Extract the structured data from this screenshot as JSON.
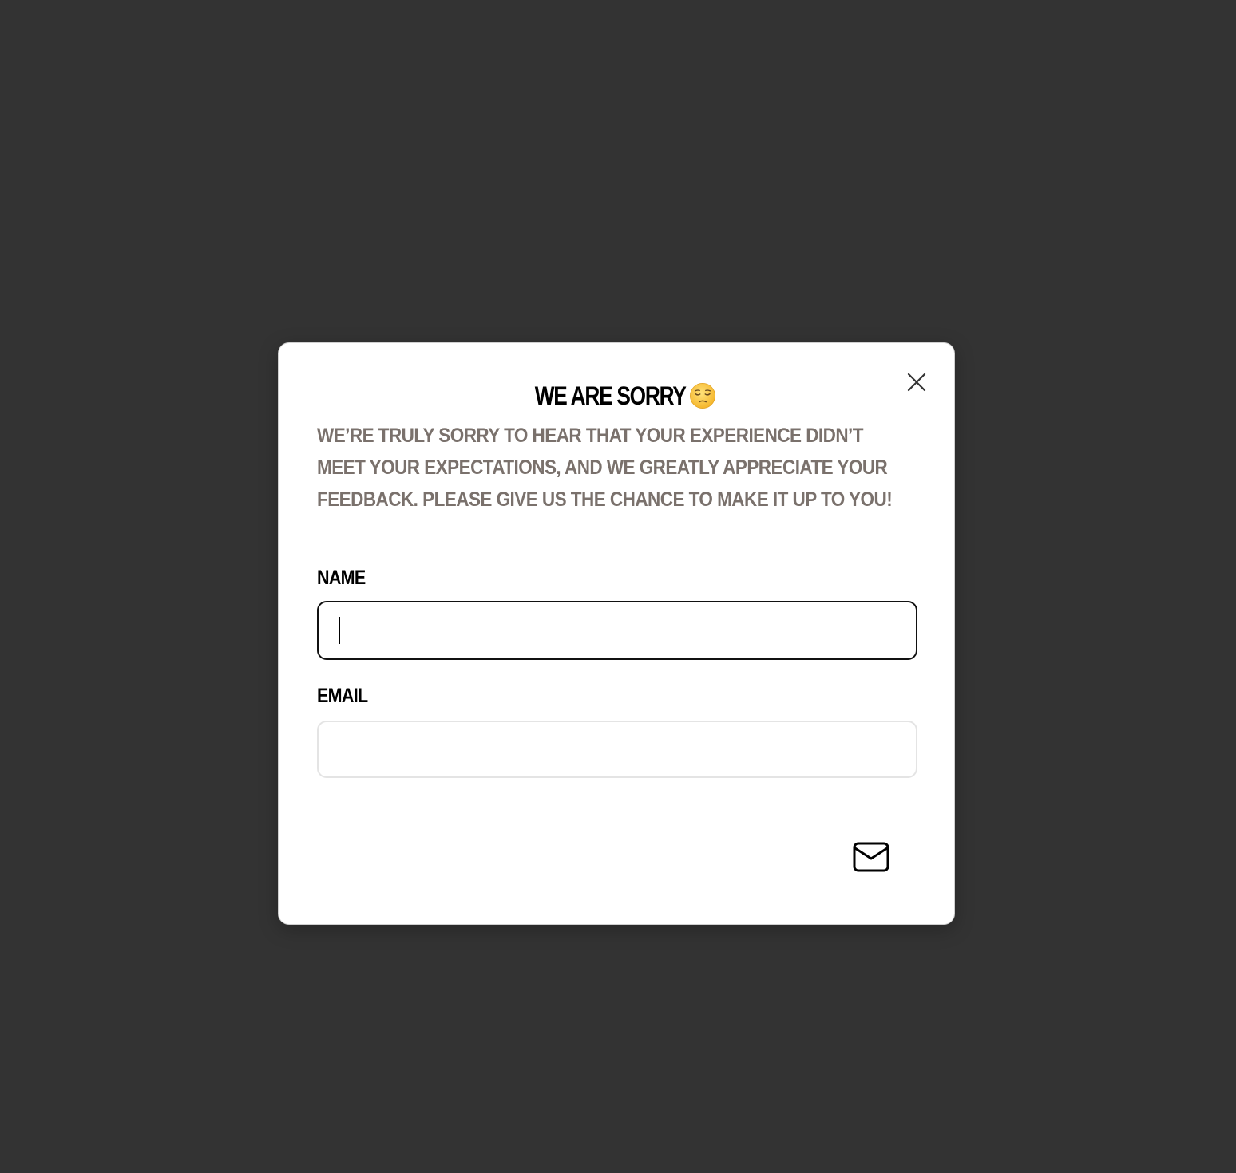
{
  "modal": {
    "title": "We are sorry",
    "title_emoji": "pensive-face-icon",
    "description": "We’re truly sorry to hear that your experience didn’t meet your expectations, and we greatly appreciate your feedback. Please give us the chance to make it up to you!",
    "close_icon": "close-icon",
    "form": {
      "name_label": "Name",
      "name_value": "",
      "name_placeholder": "",
      "email_label": "Email",
      "email_value": "",
      "email_placeholder": ""
    },
    "submit_icon": "envelope-icon"
  },
  "colors": {
    "backdrop": "#333333",
    "modal_bg": "#ffffff",
    "title": "#000000",
    "description": "#7a716c",
    "focused_border": "#111111",
    "input_border": "#e4e4e4"
  }
}
